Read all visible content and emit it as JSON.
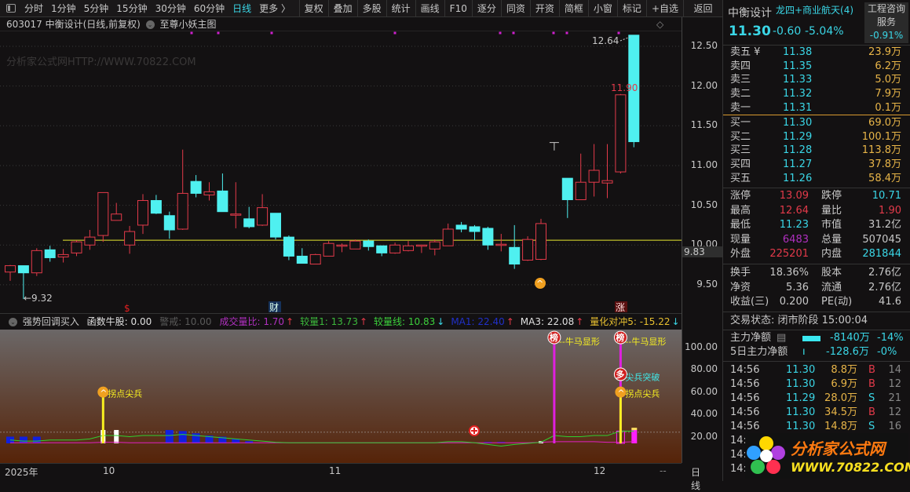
{
  "toolbar": {
    "periods": [
      "分时",
      "1分钟",
      "5分钟",
      "15分钟",
      "30分钟",
      "60分钟",
      "日线",
      "更多 〉"
    ],
    "active_period": "日线",
    "buttons": [
      "复权",
      "叠加",
      "多股",
      "统计",
      "画线",
      "F10",
      "逐分",
      "同资",
      "开资",
      "简框",
      "小窗",
      "标记",
      "+自选",
      "返回"
    ]
  },
  "chart_header": {
    "title": "603017 中衡设计(日线,前复权)",
    "indicator": "至尊小妖主图"
  },
  "watermark": "分析家公式网HTTP://WWW.70822.COM",
  "price_axis": [
    "12.50",
    "12.00",
    "11.50",
    "11.00",
    "10.50",
    "10.00",
    "9.50"
  ],
  "price_axis_values": [
    12.5,
    12.0,
    11.5,
    11.0,
    10.5,
    10.0,
    9.5
  ],
  "current_price_tag": "9.83",
  "annotations": {
    "low": "←9.32",
    "high": "12.64",
    "prev_high": "11.90",
    "marker_s": "$",
    "marker_cai": "财",
    "marker_zhang": "涨"
  },
  "support_line_price": 10.06,
  "candles": [
    [
      9.66,
      9.75,
      9.55,
      9.74
    ],
    [
      9.74,
      9.74,
      9.32,
      9.65
    ],
    [
      9.65,
      9.96,
      9.61,
      9.93
    ],
    [
      9.94,
      9.99,
      9.79,
      9.84
    ],
    [
      9.85,
      9.95,
      9.78,
      9.88
    ],
    [
      9.9,
      10.06,
      9.86,
      10.04
    ],
    [
      10.0,
      10.19,
      9.94,
      10.1
    ],
    [
      10.12,
      10.66,
      10.04,
      10.66
    ],
    [
      10.31,
      10.53,
      10.31,
      10.39
    ],
    [
      10.0,
      10.24,
      9.89,
      10.17
    ],
    [
      10.25,
      10.64,
      10.14,
      10.56
    ],
    [
      10.56,
      10.63,
      10.39,
      10.4
    ],
    [
      10.37,
      10.42,
      10.08,
      10.19
    ],
    [
      10.2,
      11.2,
      10.19,
      10.65
    ],
    [
      10.8,
      10.88,
      10.6,
      10.65
    ],
    [
      10.63,
      10.79,
      10.56,
      10.67
    ],
    [
      10.68,
      10.9,
      10.42,
      10.42
    ],
    [
      10.38,
      10.79,
      10.21,
      10.39
    ],
    [
      10.33,
      10.48,
      10.21,
      10.23
    ],
    [
      10.25,
      10.64,
      10.24,
      10.47
    ],
    [
      10.4,
      10.4,
      10.07,
      10.1
    ],
    [
      10.1,
      10.12,
      9.81,
      9.86
    ],
    [
      9.86,
      9.96,
      9.77,
      9.77
    ],
    [
      9.76,
      9.89,
      9.76,
      9.88
    ],
    [
      9.86,
      10.05,
      9.86,
      10.02
    ],
    [
      10.0,
      10.02,
      9.91,
      10.0
    ],
    [
      9.95,
      10.07,
      9.95,
      10.05
    ],
    [
      10.05,
      10.07,
      9.93,
      9.98
    ],
    [
      9.99,
      9.99,
      9.86,
      9.9
    ],
    [
      9.9,
      10.03,
      9.89,
      10.0
    ],
    [
      9.93,
      10.05,
      9.92,
      9.99
    ],
    [
      9.99,
      10.0,
      9.9,
      10.0
    ],
    [
      9.95,
      10.07,
      9.87,
      10.04
    ],
    [
      9.99,
      10.27,
      9.99,
      10.2
    ],
    [
      10.25,
      10.29,
      10.16,
      10.2
    ],
    [
      10.23,
      10.25,
      10.06,
      10.17
    ],
    [
      10.21,
      10.23,
      9.94,
      10.0
    ],
    [
      10.0,
      10.14,
      9.92,
      10.01
    ],
    [
      9.97,
      10.25,
      9.7,
      9.76
    ],
    [
      9.81,
      10.11,
      9.8,
      10.07
    ],
    [
      9.82,
      10.33,
      9.81,
      10.27
    ],
    null,
    [
      10.84,
      10.84,
      10.34,
      10.57
    ],
    [
      10.57,
      11.15,
      10.57,
      10.79
    ],
    [
      10.79,
      11.27,
      10.61,
      10.94
    ],
    [
      10.78,
      11.27,
      10.59,
      10.81
    ],
    [
      10.92,
      11.9,
      10.9,
      11.89
    ],
    [
      12.64,
      12.64,
      11.23,
      11.3
    ]
  ],
  "indicator": {
    "name": "强势回调买入",
    "items": [
      {
        "label": "函数牛股: 0.00",
        "color": "#e0e0e0"
      },
      {
        "label": "警戒: 10.00",
        "color": "#5a5a5a"
      },
      {
        "label": "成交量比: 1.70",
        "color": "#b030c0",
        "arrow": "↑",
        "arrow_color": "#e33a4a"
      },
      {
        "label": "较量1: 13.73",
        "color": "#3cb83c",
        "arrow": "↑",
        "arrow_color": "#e33a4a"
      },
      {
        "label": "较量线: 10.83",
        "color": "#3cd03c",
        "arrow": "↓",
        "arrow_color": "#3ad6e6"
      },
      {
        "label": "MA1: 22.40",
        "color": "#2030c8",
        "arrow": "↑",
        "arrow_color": "#e33a4a"
      },
      {
        "label": "MA3: 22.08",
        "color": "#e0e0e0",
        "arrow": "↑",
        "arrow_color": "#e33a4a"
      },
      {
        "label": "量化对冲5: -15.22",
        "color": "#e8c030",
        "arrow": "↓",
        "arrow_color": "#3ad6e6"
      }
    ],
    "axis": [
      "100.00",
      "80.00",
      "60.00",
      "40.00",
      "20.00"
    ],
    "axis_values": [
      100,
      80,
      60,
      40,
      20
    ],
    "green": [
      3,
      2,
      2,
      3,
      3,
      3,
      4,
      7,
      7,
      6,
      7,
      7,
      7,
      8,
      7,
      6,
      5,
      4,
      3,
      2,
      1,
      0.5,
      0.5,
      0.5,
      0.5,
      0.5,
      0.5,
      0.5,
      0.5,
      0.5,
      0.5,
      0.5,
      0.5,
      1.5,
      1.5,
      0.5,
      -1,
      -2.5,
      -1,
      0,
      1,
      7,
      6,
      6,
      7,
      7,
      11,
      11
    ],
    "magenta": [
      0.5,
      0.5,
      0.5,
      0.5,
      0.5,
      0.5,
      0.5,
      1,
      1,
      0.5,
      0.5,
      0.5,
      0.5,
      0.5,
      0.5,
      0.5,
      0.5,
      0.5,
      0.5,
      0.5,
      0.5,
      0.5,
      0.5,
      0.5,
      0.5,
      0.5,
      0.5,
      0.5,
      0.5,
      0.5,
      0.5,
      0.5,
      0.5,
      0.5,
      0.5,
      0.5,
      0.5,
      0.5,
      0.5,
      0.5,
      1,
      1.5,
      1.5,
      1.5,
      1.5,
      1,
      1,
      1.5
    ],
    "blue_bars": {
      "0": 6,
      "1": 6,
      "2": 6,
      "12": 12,
      "13": 11,
      "14": 9,
      "15": 7,
      "16": 6,
      "17": 4,
      "18": 2,
      "36": 1.5,
      "37": 1.5
    },
    "white_bars": {
      "7": 12,
      "8": 12,
      "40": 2
    },
    "warning_level": 10,
    "signals": [
      {
        "slot": 7,
        "type": "拐点尖兵",
        "value": 42
      },
      {
        "slot": 41,
        "type": "牛马显形",
        "value": 95
      },
      {
        "slot": 46,
        "type": "牛马显形",
        "value": 95
      },
      {
        "slot": 46,
        "type": "尖兵突破",
        "value": 62
      },
      {
        "slot": 46,
        "type": "拐点尖兵",
        "value": 44
      }
    ],
    "labels": {
      "bang": "榜",
      "duo": "多",
      "niuma": "--牛马显形",
      "jianbing_tupo": "尖兵突破",
      "guaidian": "拐点尖兵"
    }
  },
  "date_axis": {
    "year": "2025年",
    "m10": "10",
    "m11": "11",
    "m12": "12",
    "dash": "--",
    "period": "日线"
  },
  "quote": {
    "name": "中衡设计",
    "tag": "龙四+商业航天(4)",
    "sector": "工程咨询服务",
    "sector_change": "-0.91%",
    "price": "11.30",
    "change": "-0.60",
    "change_pct": "-5.04%"
  },
  "asks": [
    {
      "label": "卖五 ¥",
      "price": "11.38",
      "vol": "23.9万"
    },
    {
      "label": "卖四",
      "price": "11.35",
      "vol": "6.2万"
    },
    {
      "label": "卖三",
      "price": "11.33",
      "vol": "5.0万"
    },
    {
      "label": "卖二",
      "price": "11.32",
      "vol": "7.9万"
    },
    {
      "label": "卖一",
      "price": "11.31",
      "vol": "0.1万"
    }
  ],
  "bids": [
    {
      "label": "买一",
      "price": "11.30",
      "vol": "69.0万"
    },
    {
      "label": "买二",
      "price": "11.29",
      "vol": "100.1万"
    },
    {
      "label": "买三",
      "price": "11.28",
      "vol": "113.8万"
    },
    {
      "label": "买四",
      "price": "11.27",
      "vol": "37.8万"
    },
    {
      "label": "买五",
      "price": "11.26",
      "vol": "58.4万"
    }
  ],
  "stats": [
    {
      "l1": "涨停",
      "v1": "13.09",
      "c1": "rd",
      "l2": "跌停",
      "v2": "10.71",
      "c2": "cy"
    },
    {
      "l1": "最高",
      "v1": "12.64",
      "c1": "rd",
      "l2": "量比",
      "v2": "1.90",
      "c2": "rd"
    },
    {
      "l1": "最低",
      "v1": "11.23",
      "c1": "cy",
      "l2": "市值",
      "v2": "31.2亿",
      "c2": "wt"
    },
    {
      "l1": "现量",
      "v1": "6483",
      "c1": "pp",
      "l2": "总量",
      "v2": "507045",
      "c2": "wt"
    },
    {
      "l1": "外盘",
      "v1": "225201",
      "c1": "rd",
      "l2": "内盘",
      "v2": "281844",
      "c2": "cy"
    }
  ],
  "stats2": [
    {
      "l1": "换手",
      "v1": "18.36%",
      "l2": "股本",
      "v2": "2.76亿"
    },
    {
      "l1": "净资",
      "v1": "5.36",
      "l2": "流通",
      "v2": "2.76亿"
    },
    {
      "l1": "收益(三)",
      "v1": "0.200",
      "l2": "PE(动)",
      "v2": "41.6"
    }
  ],
  "trade_status": "交易状态: 闭市阶段 15:00:04",
  "main_flow": {
    "label": "主力净额",
    "value": "-8140万",
    "pct": "-14%"
  },
  "main_flow5": {
    "label": "5日主力净额",
    "value": "-128.6万",
    "pct": "-0%"
  },
  "ticks": [
    {
      "t": "14:56",
      "p": "11.30",
      "v": "8.8万",
      "bs": "B",
      "n": "14"
    },
    {
      "t": "14:56",
      "p": "11.30",
      "v": "6.9万",
      "bs": "B",
      "n": "12"
    },
    {
      "t": "14:56",
      "p": "11.29",
      "v": "28.0万",
      "bs": "S",
      "n": "21"
    },
    {
      "t": "14:56",
      "p": "11.30",
      "v": "34.5万",
      "bs": "B",
      "n": "12"
    },
    {
      "t": "14:56",
      "p": "11.30",
      "v": "14.8万",
      "bs": "S",
      "n": "16"
    },
    {
      "t": "14:5",
      "p": "",
      "v": "",
      "bs": "",
      "n": ""
    },
    {
      "t": "14:5",
      "p": "",
      "v": "",
      "bs": "",
      "n": ""
    },
    {
      "t": "14:5",
      "p": "",
      "v": "",
      "bs": "",
      "n": ""
    }
  ],
  "logo": {
    "title": "分析家公式网",
    "url": "WWW.70822.COM"
  },
  "colors": {
    "up": "#e33a4a",
    "down": "#4ff0f0",
    "accent": "#3ad6e6",
    "support": "#e8e830"
  }
}
